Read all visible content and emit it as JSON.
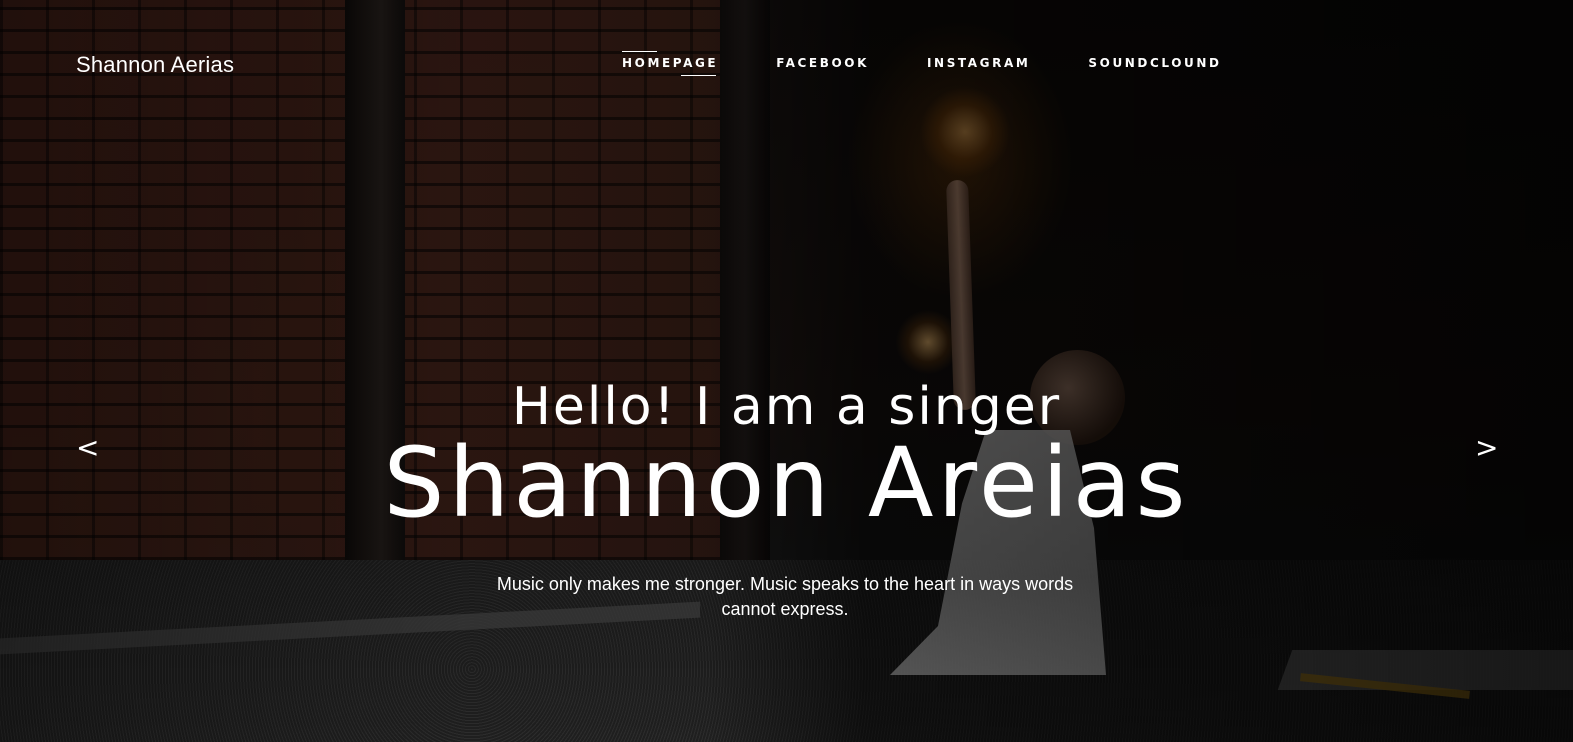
{
  "brand": {
    "name": "Shannon Aerias"
  },
  "nav": {
    "items": [
      {
        "label": "HOMEPAGE",
        "active": true
      },
      {
        "label": "FACEBOOK",
        "active": false
      },
      {
        "label": "INSTAGRAM",
        "active": false
      },
      {
        "label": "SOUNDCLOUND",
        "active": false
      }
    ]
  },
  "hero": {
    "subtitle": "Hello! I am a singer",
    "title": "Shannon Areias",
    "tagline": "Music only makes me stronger. Music speaks to the heart in ways words cannot express.",
    "prev_label": "<",
    "next_label": ">"
  },
  "icons": {
    "prev": "chevron-left-icon",
    "next": "chevron-right-icon"
  },
  "colors": {
    "text": "#ffffff",
    "light_glow": "#ff9a1f",
    "background": "#0e0b0a"
  }
}
